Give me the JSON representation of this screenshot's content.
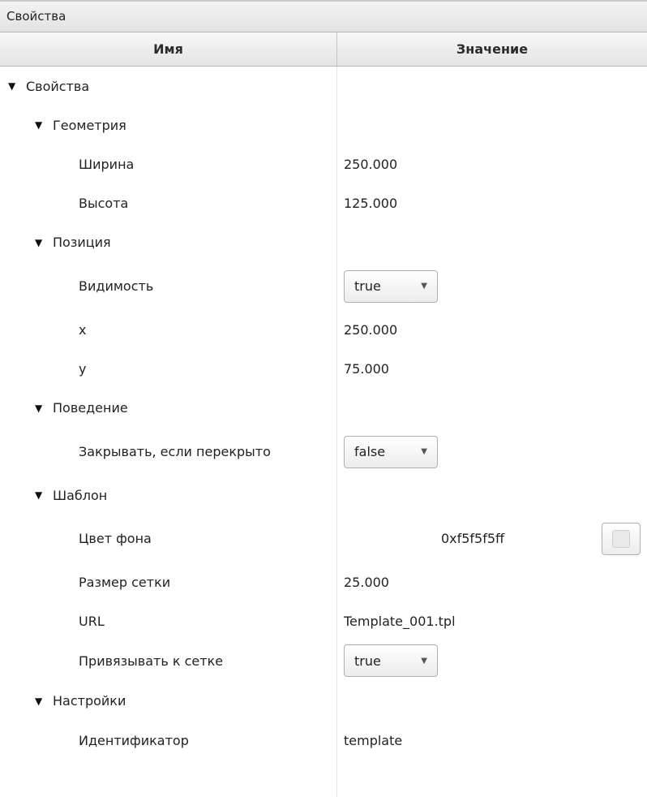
{
  "panel": {
    "title": "Свойства"
  },
  "columns": {
    "name": "Имя",
    "value": "Значение"
  },
  "rows": {
    "root": {
      "label": "Свойства"
    },
    "geometry": {
      "label": "Геометрия"
    },
    "width": {
      "label": "Ширина",
      "value": "250.000"
    },
    "height": {
      "label": "Высота",
      "value": "125.000"
    },
    "position": {
      "label": "Позиция"
    },
    "visibility": {
      "label": "Видимость",
      "value": "true"
    },
    "x": {
      "label": "x",
      "value": "250.000"
    },
    "y": {
      "label": "y",
      "value": "75.000"
    },
    "behavior": {
      "label": "Поведение"
    },
    "close_if_overlapped": {
      "label": "Закрывать, если перекрыто",
      "value": "false"
    },
    "template": {
      "label": "Шаблон"
    },
    "bg_color": {
      "label": "Цвет фона",
      "value": "0xf5f5f5ff",
      "swatch_color": "#f5f5f5"
    },
    "grid_size": {
      "label": "Размер сетки",
      "value": "25.000"
    },
    "url": {
      "label": "URL",
      "value": "Template_001.tpl"
    },
    "snap_to_grid": {
      "label": "Привязывать к сетке",
      "value": "true"
    },
    "settings": {
      "label": "Настройки"
    },
    "identifier": {
      "label": "Идентификатор",
      "value": "template"
    }
  }
}
